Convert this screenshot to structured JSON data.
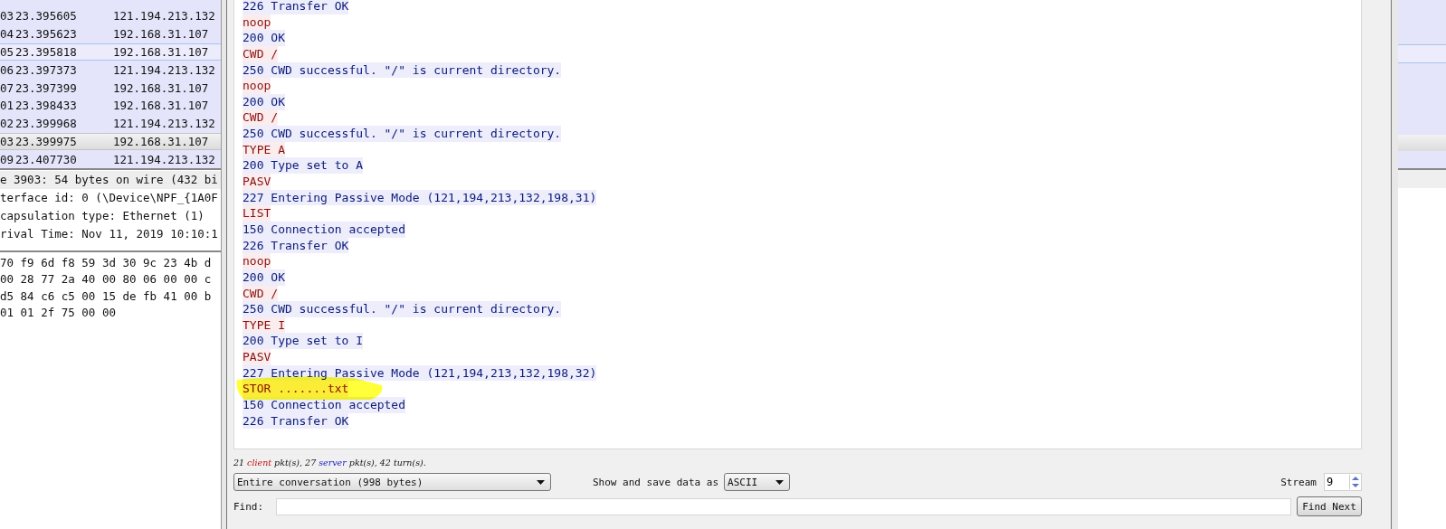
{
  "packet_list": {
    "rows": [
      {
        "no": "03",
        "time": "23.395605",
        "source": "121.194.213.132",
        "selected": false,
        "hovered": false
      },
      {
        "no": "04",
        "time": "23.395623",
        "source": "192.168.31.107",
        "selected": false,
        "hovered": false
      },
      {
        "no": "05",
        "time": "23.395818",
        "source": "192.168.31.107",
        "selected": false,
        "hovered": true
      },
      {
        "no": "06",
        "time": "23.397373",
        "source": "121.194.213.132",
        "selected": false,
        "hovered": false
      },
      {
        "no": "07",
        "time": "23.397399",
        "source": "192.168.31.107",
        "selected": false,
        "hovered": false
      },
      {
        "no": "01",
        "time": "23.398433",
        "source": "192.168.31.107",
        "selected": false,
        "hovered": false
      },
      {
        "no": "02",
        "time": "23.399968",
        "source": "121.194.213.132",
        "selected": false,
        "hovered": false
      },
      {
        "no": "03",
        "time": "23.399975",
        "source": "192.168.31.107",
        "selected": true,
        "hovered": false
      },
      {
        "no": "09",
        "time": "23.407730",
        "source": "121.194.213.132",
        "selected": false,
        "hovered": false
      }
    ]
  },
  "packet_details": {
    "lines": [
      {
        "text": "e 3903: 54 bytes on wire (432 bi",
        "selected": true
      },
      {
        "text": "terface id: 0 (\\Device\\NPF_{1A0F",
        "selected": false
      },
      {
        "text": "capsulation type: Ethernet (1)",
        "selected": false
      },
      {
        "text": "rival Time: Nov 11, 2019 10:10:1",
        "selected": false
      }
    ]
  },
  "packet_bytes": {
    "lines": [
      "70 f9 6d f8 59 3d 30 9c  23 4b d",
      "00 28 77 2a 40 00 80 06  00 00 c",
      "d5 84 c6 c5 00 15 de fb  41 00 b",
      "01 01 2f 75 00 00"
    ]
  },
  "follow_stream": {
    "lines": [
      {
        "text": "226 Transfer OK",
        "kind": "server"
      },
      {
        "text": "noop",
        "kind": "client"
      },
      {
        "text": "200 OK",
        "kind": "server"
      },
      {
        "text": "CWD /",
        "kind": "client"
      },
      {
        "text": "250 CWD successful. \"/\" is current directory.",
        "kind": "server"
      },
      {
        "text": "noop",
        "kind": "client"
      },
      {
        "text": "200 OK",
        "kind": "server"
      },
      {
        "text": "CWD /",
        "kind": "client"
      },
      {
        "text": "250 CWD successful. \"/\" is current directory.",
        "kind": "server"
      },
      {
        "text": "TYPE A",
        "kind": "client"
      },
      {
        "text": "200 Type set to A",
        "kind": "server"
      },
      {
        "text": "PASV",
        "kind": "client"
      },
      {
        "text": "227 Entering Passive Mode (121,194,213,132,198,31)",
        "kind": "server"
      },
      {
        "text": "LIST",
        "kind": "client"
      },
      {
        "text": "150 Connection accepted",
        "kind": "server"
      },
      {
        "text": "226 Transfer OK",
        "kind": "server"
      },
      {
        "text": "noop",
        "kind": "client"
      },
      {
        "text": "200 OK",
        "kind": "server"
      },
      {
        "text": "CWD /",
        "kind": "client"
      },
      {
        "text": "250 CWD successful. \"/\" is current directory.",
        "kind": "server"
      },
      {
        "text": "TYPE I",
        "kind": "client"
      },
      {
        "text": "200 Type set to I",
        "kind": "server"
      },
      {
        "text": "PASV",
        "kind": "client"
      },
      {
        "text": "227 Entering Passive Mode (121,194,213,132,198,32)",
        "kind": "server"
      },
      {
        "text": "STOR .......txt",
        "kind": "client"
      },
      {
        "text": "150 Connection accepted",
        "kind": "server"
      },
      {
        "text": "226 Transfer OK",
        "kind": "server"
      }
    ],
    "summary": [
      {
        "text": "21 ",
        "kind": "plain"
      },
      {
        "text": "client",
        "kind": "client"
      },
      {
        "text": " pkt(s), 27 ",
        "kind": "plain"
      },
      {
        "text": "server",
        "kind": "server"
      },
      {
        "text": " pkt(s), 42 turn(s).",
        "kind": "plain"
      }
    ],
    "range": "Entire conversation (998 bytes)",
    "format_label": "Show and save data as",
    "format": "ASCII",
    "stream_label": "Stream",
    "stream": "9",
    "find_label": "Find:",
    "find_button": "Find Next"
  }
}
